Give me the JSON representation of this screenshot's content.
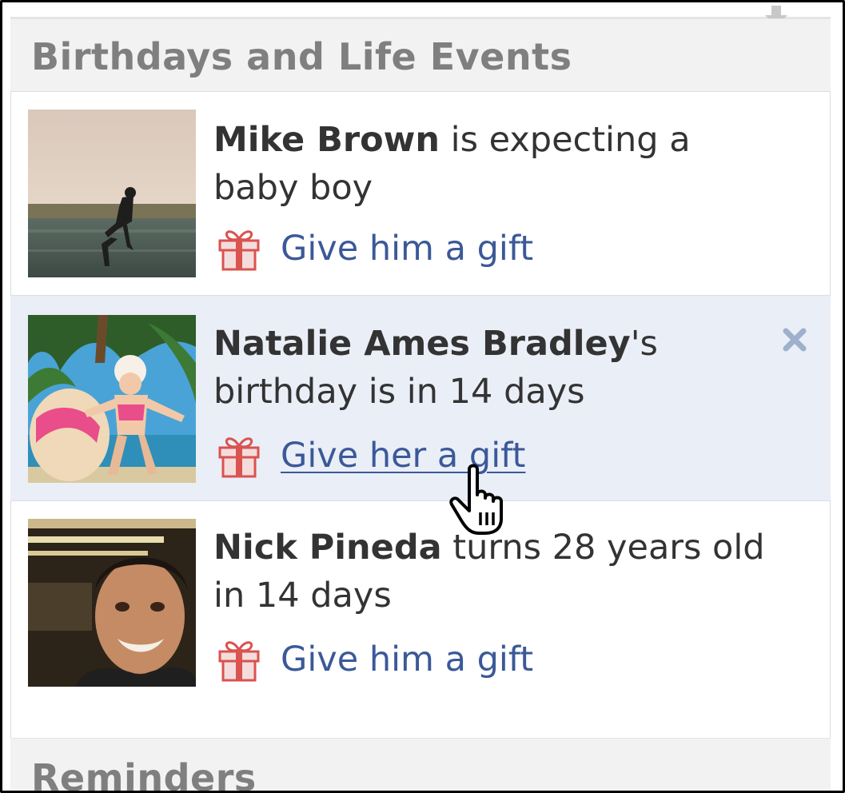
{
  "header": {
    "title": "Birthdays and Life Events",
    "download_icon": "download-icon"
  },
  "events": [
    {
      "name": "Mike Brown",
      "text_1": " is expecting a",
      "text_2": "baby boy",
      "gift_label": "Give him a gift",
      "photo": "person-jumping-on-beach-photo",
      "highlighted": false
    },
    {
      "name": "Natalie Ames Bradley",
      "text_1": "'s",
      "text_2": "birthday is in 14 days",
      "gift_label": "Give her a gift",
      "photo": "woman-with-child-under-palm-tree-photo",
      "highlighted": true,
      "dismiss_icon": "close-icon"
    },
    {
      "name": "Nick Pineda",
      "text_1": " turns 28 years old",
      "text_2": "in 14 days",
      "gift_label": "Give him a gift",
      "photo": "smiling-man-portrait-photo",
      "highlighted": false
    }
  ],
  "reminders": {
    "title": "Reminders"
  },
  "colors": {
    "link": "#3b5998",
    "highlight_bg": "#eaeef7",
    "header_bg": "#f2f2f2",
    "header_text": "#7f7f7f",
    "gift_red": "#d9534f"
  },
  "cursor": "hand-pointer-icon"
}
